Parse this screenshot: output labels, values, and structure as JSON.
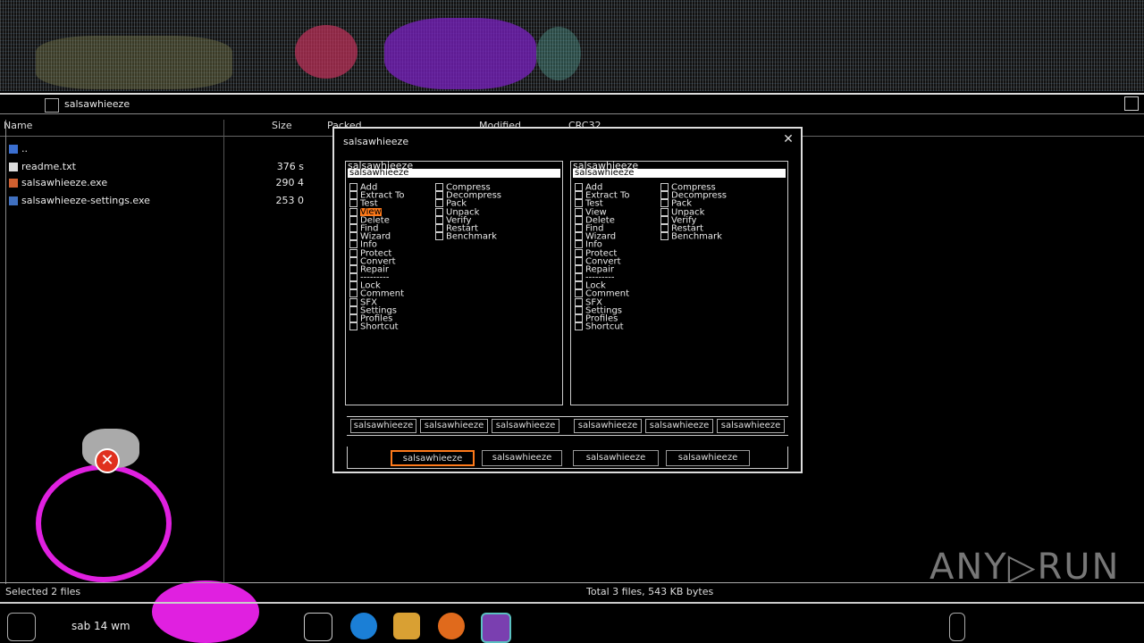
{
  "window": {
    "title": "salsawhieeze",
    "columns": [
      "Name",
      "Size",
      "Packed",
      "Modified",
      "CRC32"
    ]
  },
  "files": [
    {
      "name": "..",
      "size": ""
    },
    {
      "name": "readme.txt",
      "size": "376 s"
    },
    {
      "name": "salsawhieeze.exe",
      "size": "290 4"
    },
    {
      "name": "salsawhieeze-settings.exe",
      "size": "253 0"
    }
  ],
  "dialog": {
    "title": "salsawhieeze",
    "left_pane": {
      "header": "salsawhieeze",
      "bar": "salsawhieeze"
    },
    "right_pane": {
      "header": "salsawhieeze",
      "bar": "salsawhieeze"
    },
    "list_col1": [
      "Add",
      "Extract To",
      "Test",
      "View",
      "Delete",
      "Find",
      "Wizard",
      "Info",
      "Protect",
      "Convert",
      "Repair",
      "---------",
      "Lock",
      "Comment",
      "SFX",
      "Settings",
      "Profiles",
      "Shortcut"
    ],
    "list_col2": [
      "Compress",
      "Decompress",
      "Pack",
      "Unpack",
      "Verify",
      "Restart",
      "Benchmark"
    ],
    "selected_index": 3,
    "row_buttons": [
      "salsawhieeze",
      "salsawhieeze",
      "salsawhieeze",
      "salsawhieeze",
      "salsawhieeze",
      "salsawhieeze"
    ],
    "bottom_buttons": [
      "salsawhieeze",
      "salsawhieeze",
      "salsawhieeze",
      "salsawhieeze"
    ]
  },
  "status": {
    "left": "Selected 2 files",
    "right": "Total 3 files, 543 KB bytes"
  },
  "taskbar": {
    "clock": "sab 14 wm"
  },
  "watermark": "ANY▷RUN",
  "colors": {
    "accent": "#ff7a1a",
    "magenta": "#e020e0",
    "error": "#e0301e"
  }
}
